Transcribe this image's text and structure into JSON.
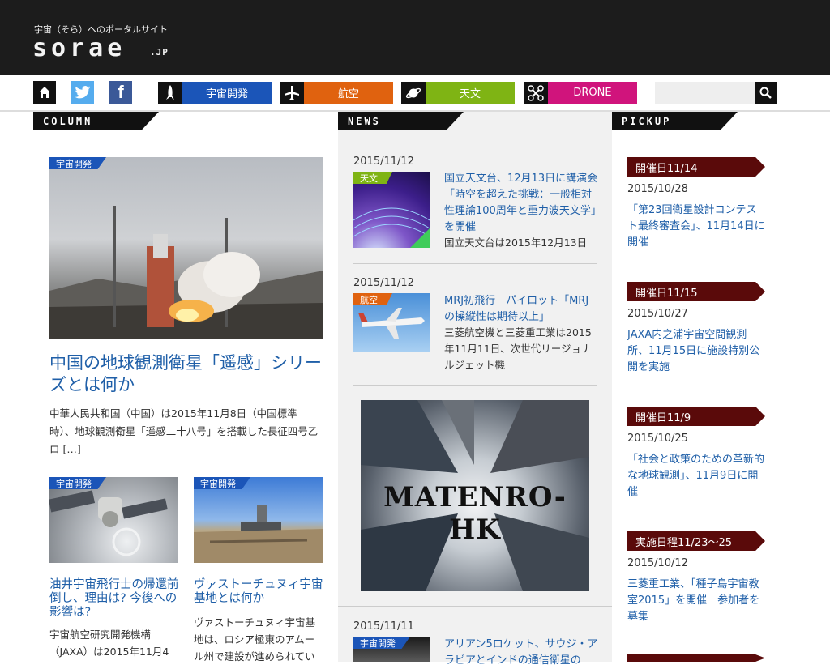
{
  "header": {
    "tagline": "宇宙（そら）へのポータルサイト",
    "logo": "sorae",
    "logo_suffix": ".JP"
  },
  "nav": {
    "icons": [
      "home-icon",
      "twitter-icon",
      "facebook-icon"
    ],
    "categories": [
      {
        "label": "宇宙開発",
        "color": "#1b55b8",
        "icon": "rocket-icon"
      },
      {
        "label": "航空",
        "color": "#e0620f",
        "icon": "airplane-icon"
      },
      {
        "label": "天文",
        "color": "#7fb414",
        "icon": "planet-icon"
      },
      {
        "label": "DRONE",
        "color": "#d0147c",
        "icon": "drone-icon"
      }
    ],
    "search_placeholder": ""
  },
  "sections": {
    "column": "COLUMN",
    "news": "NEWS",
    "pickup": "PICKUP"
  },
  "column": {
    "main": {
      "badge": "宇宙開発",
      "title": "中国の地球観測衛星「遥感」シリーズとは何か",
      "excerpt": "中華人民共和国（中国）は2015年11月8日（中国標準時）、地球観測衛星「遥感二十八号」を搭載した長征四号乙ロ […]"
    },
    "sub": [
      {
        "badge": "宇宙開発",
        "title": "油井宇宙飛行士の帰還前倒し、理由は? 今後への影響は?",
        "excerpt": "宇宙航空研究開発機構（JAXA）は2015年11月4"
      },
      {
        "badge": "宇宙開発",
        "title": "ヴァストーチュヌィ宇宙基地とは何か",
        "excerpt": "ヴァストーチュヌィ宇宙基地は、ロシア極東のアムール州で建設が進められてい"
      }
    ]
  },
  "news": {
    "items": [
      {
        "date": "2015/11/12",
        "badge": "天文",
        "badge_color": "#7fb414",
        "title": "国立天文台、12月13日に講演会「時空を超えた挑戦：一般相対性理論100周年と重力波天文学」を開催",
        "desc": "国立天文台は2015年12月13日"
      },
      {
        "date": "2015/11/12",
        "badge": "航空",
        "badge_color": "#e0620f",
        "title": "MRJ初飛行　パイロット「MRJの操縦性は期待以上」",
        "desc": "三菱航空機と三菱重工業は2015年11月11日、次世代リージョナルジェット機"
      },
      {
        "date": "2015/11/11",
        "badge": "宇宙開発",
        "badge_color": "#1b55b8",
        "title": "アリアン5ロケット、サウジ・アラビアとインドの通信衛星の",
        "desc": ""
      }
    ],
    "ad_text": "MATENRO-HK"
  },
  "pickup": {
    "items": [
      {
        "tag": "開催日11/14",
        "date": "2015/10/28",
        "title": "「第23回衛星設計コンテスト最終審査会」、11月14日に開催"
      },
      {
        "tag": "開催日11/15",
        "date": "2015/10/27",
        "title": "JAXA内之浦宇宙空間観測所、11月15日に施設特別公開を実施"
      },
      {
        "tag": "開催日11/9",
        "date": "2015/10/25",
        "title": "「社会と政策のための革新的な地球観測」、11月9日に開催"
      },
      {
        "tag": "実施日程11/23〜25",
        "date": "2015/10/12",
        "title": "三菱重工業、「種子島宇宙教室2015」を開催　参加者を募集"
      }
    ]
  }
}
